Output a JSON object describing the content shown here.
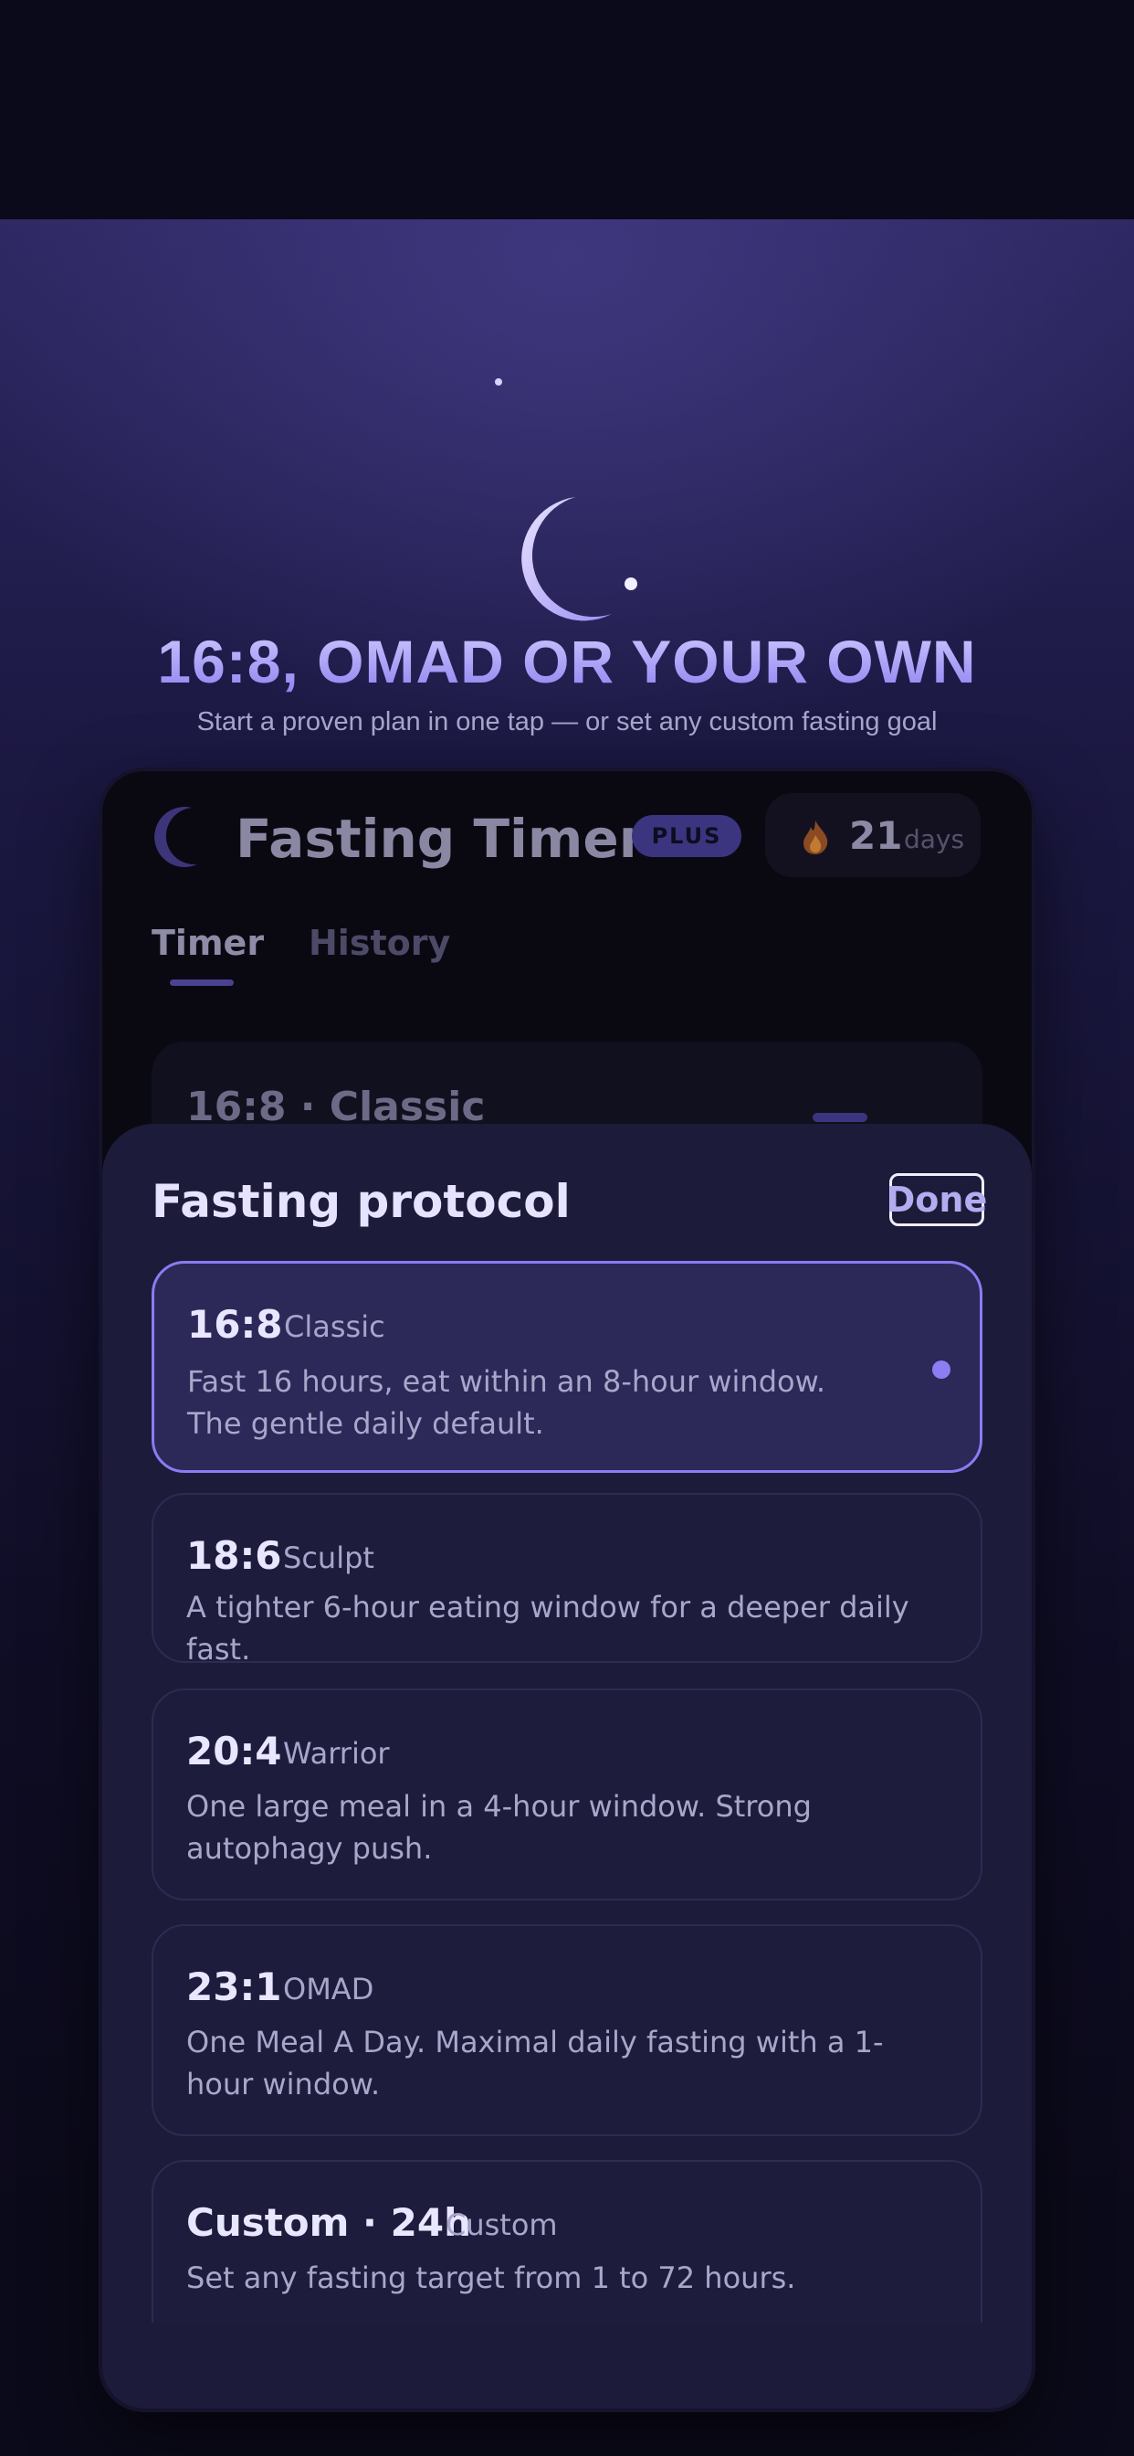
{
  "hero": {
    "headline": "16:8, OMAD OR YOUR OWN",
    "subline": "Start a proven plan in one tap — or set any custom fasting goal",
    "icon": "crescent-moon-with-stars"
  },
  "app": {
    "title": "Fasting Timer",
    "badge": "PLUS",
    "streak": {
      "icon": "flame",
      "count": "21",
      "unit": "days"
    },
    "tabs": [
      {
        "label": "Timer",
        "active": true
      },
      {
        "label": "History",
        "active": false
      }
    ],
    "background_card": {
      "title": "16:8 · Classic"
    }
  },
  "sheet": {
    "title": "Fasting protocol",
    "done_label": "Done",
    "options": [
      {
        "ratio": "16:8",
        "name": "Classic",
        "desc": "Fast 16 hours, eat within an 8-hour window. The gentle daily default.",
        "selected": true
      },
      {
        "ratio": "18:6",
        "name": "Sculpt",
        "desc": "A tighter 6-hour eating window for a deeper daily fast.",
        "selected": false
      },
      {
        "ratio": "20:4",
        "name": "Warrior",
        "desc": "One large meal in a 4-hour window. Strong autophagy push.",
        "selected": false
      },
      {
        "ratio": "23:1",
        "name": "OMAD",
        "desc": "One Meal A Day. Maximal daily fasting with a 1-hour window.",
        "selected": false
      },
      {
        "ratio": "Custom · 24h",
        "name": "Custom",
        "desc": "Set any fasting target from 1 to 72 hours.",
        "selected": false
      }
    ]
  },
  "colors": {
    "accent": "#8a7cf2",
    "sheet_bg": "#1d1b3a",
    "page_bg": "#0b0a1a"
  }
}
